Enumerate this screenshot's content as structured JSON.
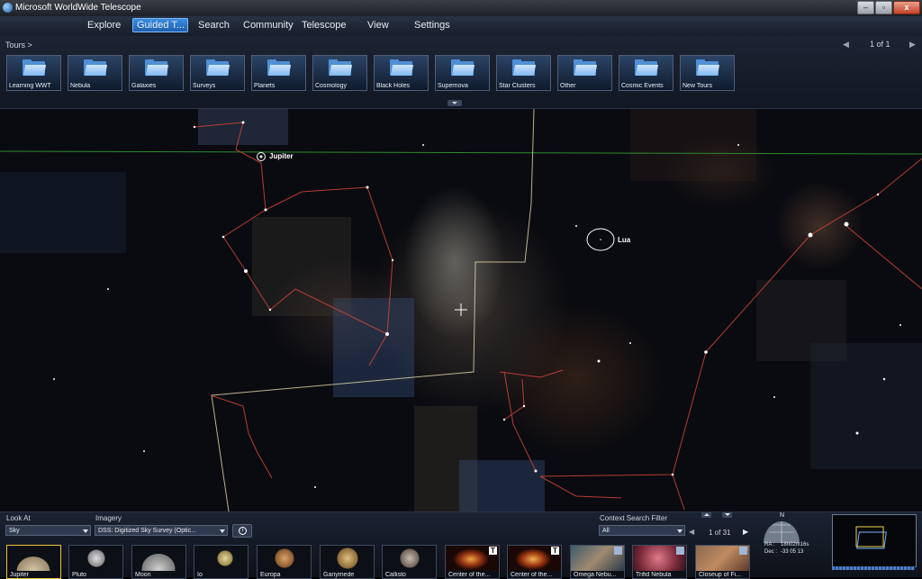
{
  "window": {
    "title": "Microsoft WorldWide Telescope",
    "minimize_icon": "minimize-icon",
    "maximize_icon": "maximize-icon",
    "close_icon": "close-icon"
  },
  "menu": {
    "items": [
      "Explore",
      "Guided T...",
      "Search",
      "Community",
      "Telescope",
      "View",
      "Settings"
    ],
    "active": "Guided T..."
  },
  "tours": {
    "breadcrumb": "Tours  >",
    "pager": "1 of 1",
    "tiles": [
      "Learning WWT",
      "Nebula",
      "Galaxies",
      "Surveys",
      "Planets",
      "Cosmology",
      "Black Holes",
      "Supernova",
      "Star Clusters",
      "Other",
      "Cosmic Events",
      "New Tours"
    ]
  },
  "sky": {
    "labels": {
      "jupiter": "Jupiter",
      "moon": "Lua"
    },
    "colors": {
      "constellation": "#d2453a",
      "boundary": "#e8dcb0",
      "horizon": "#2e8b2e"
    }
  },
  "bottom": {
    "look_at_label": "Look At",
    "look_at_value": "Sky",
    "imagery_label": "Imagery",
    "imagery_value": "DSS: Digitized Sky Survey (Optic...",
    "context_filter_label": "Context Search Filter",
    "context_filter_value": "All",
    "context_pager": "1 of 31",
    "compass_north": "N",
    "ra_label": "RA :",
    "ra_value": "18h02m16s",
    "dec_label": "Dec :",
    "dec_value": "-33 05 13",
    "thumbnails": [
      {
        "label": "Jupiter",
        "badge": ""
      },
      {
        "label": "Pluto",
        "badge": ""
      },
      {
        "label": "Moon",
        "badge": ""
      },
      {
        "label": "Io",
        "badge": ""
      },
      {
        "label": "Europa",
        "badge": ""
      },
      {
        "label": "Ganymede",
        "badge": ""
      },
      {
        "label": "Callisto",
        "badge": ""
      },
      {
        "label": "Center of the...",
        "badge": "T"
      },
      {
        "label": "Center of the...",
        "badge": "T"
      },
      {
        "label": "Omega  Nebu...",
        "badge": ""
      },
      {
        "label": "Trifid Nebula",
        "badge": ""
      },
      {
        "label": "Closeup of Fi...",
        "badge": ""
      }
    ]
  }
}
